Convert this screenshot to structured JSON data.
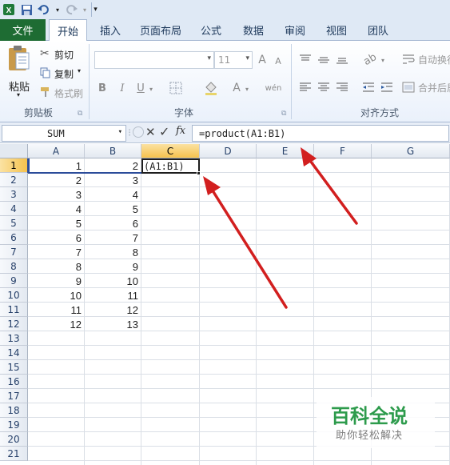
{
  "window": {
    "qat_icons": [
      "excel-logo-icon",
      "save-icon",
      "undo-icon",
      "redo-icon",
      "customize-qat-icon"
    ]
  },
  "tabs": [
    {
      "label": "文件",
      "active": false
    },
    {
      "label": "开始",
      "active": true
    },
    {
      "label": "插入",
      "active": false
    },
    {
      "label": "页面布局",
      "active": false
    },
    {
      "label": "公式",
      "active": false
    },
    {
      "label": "数据",
      "active": false
    },
    {
      "label": "审阅",
      "active": false
    },
    {
      "label": "视图",
      "active": false
    },
    {
      "label": "团队",
      "active": false
    }
  ],
  "ribbon": {
    "clipboard": {
      "label": "剪贴板",
      "paste": "粘贴",
      "cut": "剪切",
      "copy": "复制",
      "format_painter": "格式刷"
    },
    "font": {
      "label": "字体",
      "font_name": "",
      "font_size": "11",
      "grow": "A",
      "shrink": "A",
      "bold": "B",
      "italic": "I",
      "underline": "U",
      "font_color": "A",
      "phonetic": "wén"
    },
    "alignment": {
      "label": "对齐方式",
      "wrap_text": "自动换行",
      "merge_center": "合并后居"
    }
  },
  "formula_bar": {
    "name_box": "SUM",
    "fx": "fx",
    "formula": "=product(A1:B1)"
  },
  "sheet": {
    "columns": [
      "A",
      "B",
      "C",
      "D",
      "E",
      "F",
      "G"
    ],
    "rows": [
      "1",
      "2",
      "3",
      "4",
      "5",
      "6",
      "7",
      "8",
      "9",
      "10",
      "11",
      "12",
      "13",
      "14",
      "15",
      "16",
      "17",
      "18",
      "19",
      "20",
      "21"
    ],
    "selected_column": "C",
    "selected_row": "1",
    "col_a": [
      "1",
      "2",
      "3",
      "4",
      "5",
      "6",
      "7",
      "8",
      "9",
      "10",
      "11",
      "12"
    ],
    "col_b": [
      "2",
      "3",
      "4",
      "5",
      "6",
      "7",
      "8",
      "9",
      "10",
      "11",
      "12",
      "13"
    ],
    "active_cell_text": "(A1:B1)"
  },
  "watermark": {
    "title": "百科全说",
    "subtitle": "助你轻松解决"
  },
  "colors": {
    "file_tab": "#1e6c33",
    "arrow": "#d21f1f",
    "header_selected": "#f5c24d",
    "watermark_green": "#2d9b4c"
  }
}
